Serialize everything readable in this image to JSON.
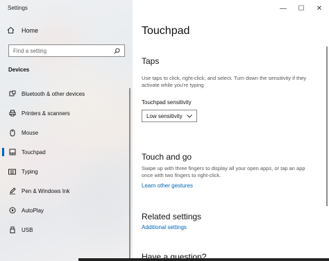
{
  "app": {
    "title": "Settings",
    "minimize_glyph": "—",
    "maximize_glyph": "☐",
    "close_glyph": "✕"
  },
  "sidebar": {
    "home_label": "Home",
    "search_placeholder": "Find a setting",
    "section_label": "Devices",
    "items": [
      {
        "label": "Bluetooth & other devices",
        "icon": "bluetooth-icon"
      },
      {
        "label": "Printers & scanners",
        "icon": "printer-icon"
      },
      {
        "label": "Mouse",
        "icon": "mouse-icon"
      },
      {
        "label": "Touchpad",
        "icon": "touchpad-icon",
        "active": true
      },
      {
        "label": "Typing",
        "icon": "keyboard-icon"
      },
      {
        "label": "Pen & Windows Ink",
        "icon": "pen-icon"
      },
      {
        "label": "AutoPlay",
        "icon": "autoplay-icon"
      },
      {
        "label": "USB",
        "icon": "usb-icon"
      }
    ]
  },
  "main": {
    "page_title": "Touchpad",
    "taps": {
      "heading": "Taps",
      "description": "Use taps to click, right-click, and select. Turn down the sensitivity if they activate while you're typing",
      "sensitivity_label": "Touchpad sensitivity",
      "sensitivity_value": "Low sensitivity"
    },
    "touch_and_go": {
      "heading": "Touch and go",
      "description": "Swipe up with three fingers to display all your open apps, or tap an app once with two fingers to right-click.",
      "link": "Learn other gestures"
    },
    "related": {
      "heading": "Related settings",
      "link": "Additional settings"
    },
    "question": {
      "heading": "Have a question?"
    }
  },
  "colors": {
    "accent": "#0063b1"
  }
}
